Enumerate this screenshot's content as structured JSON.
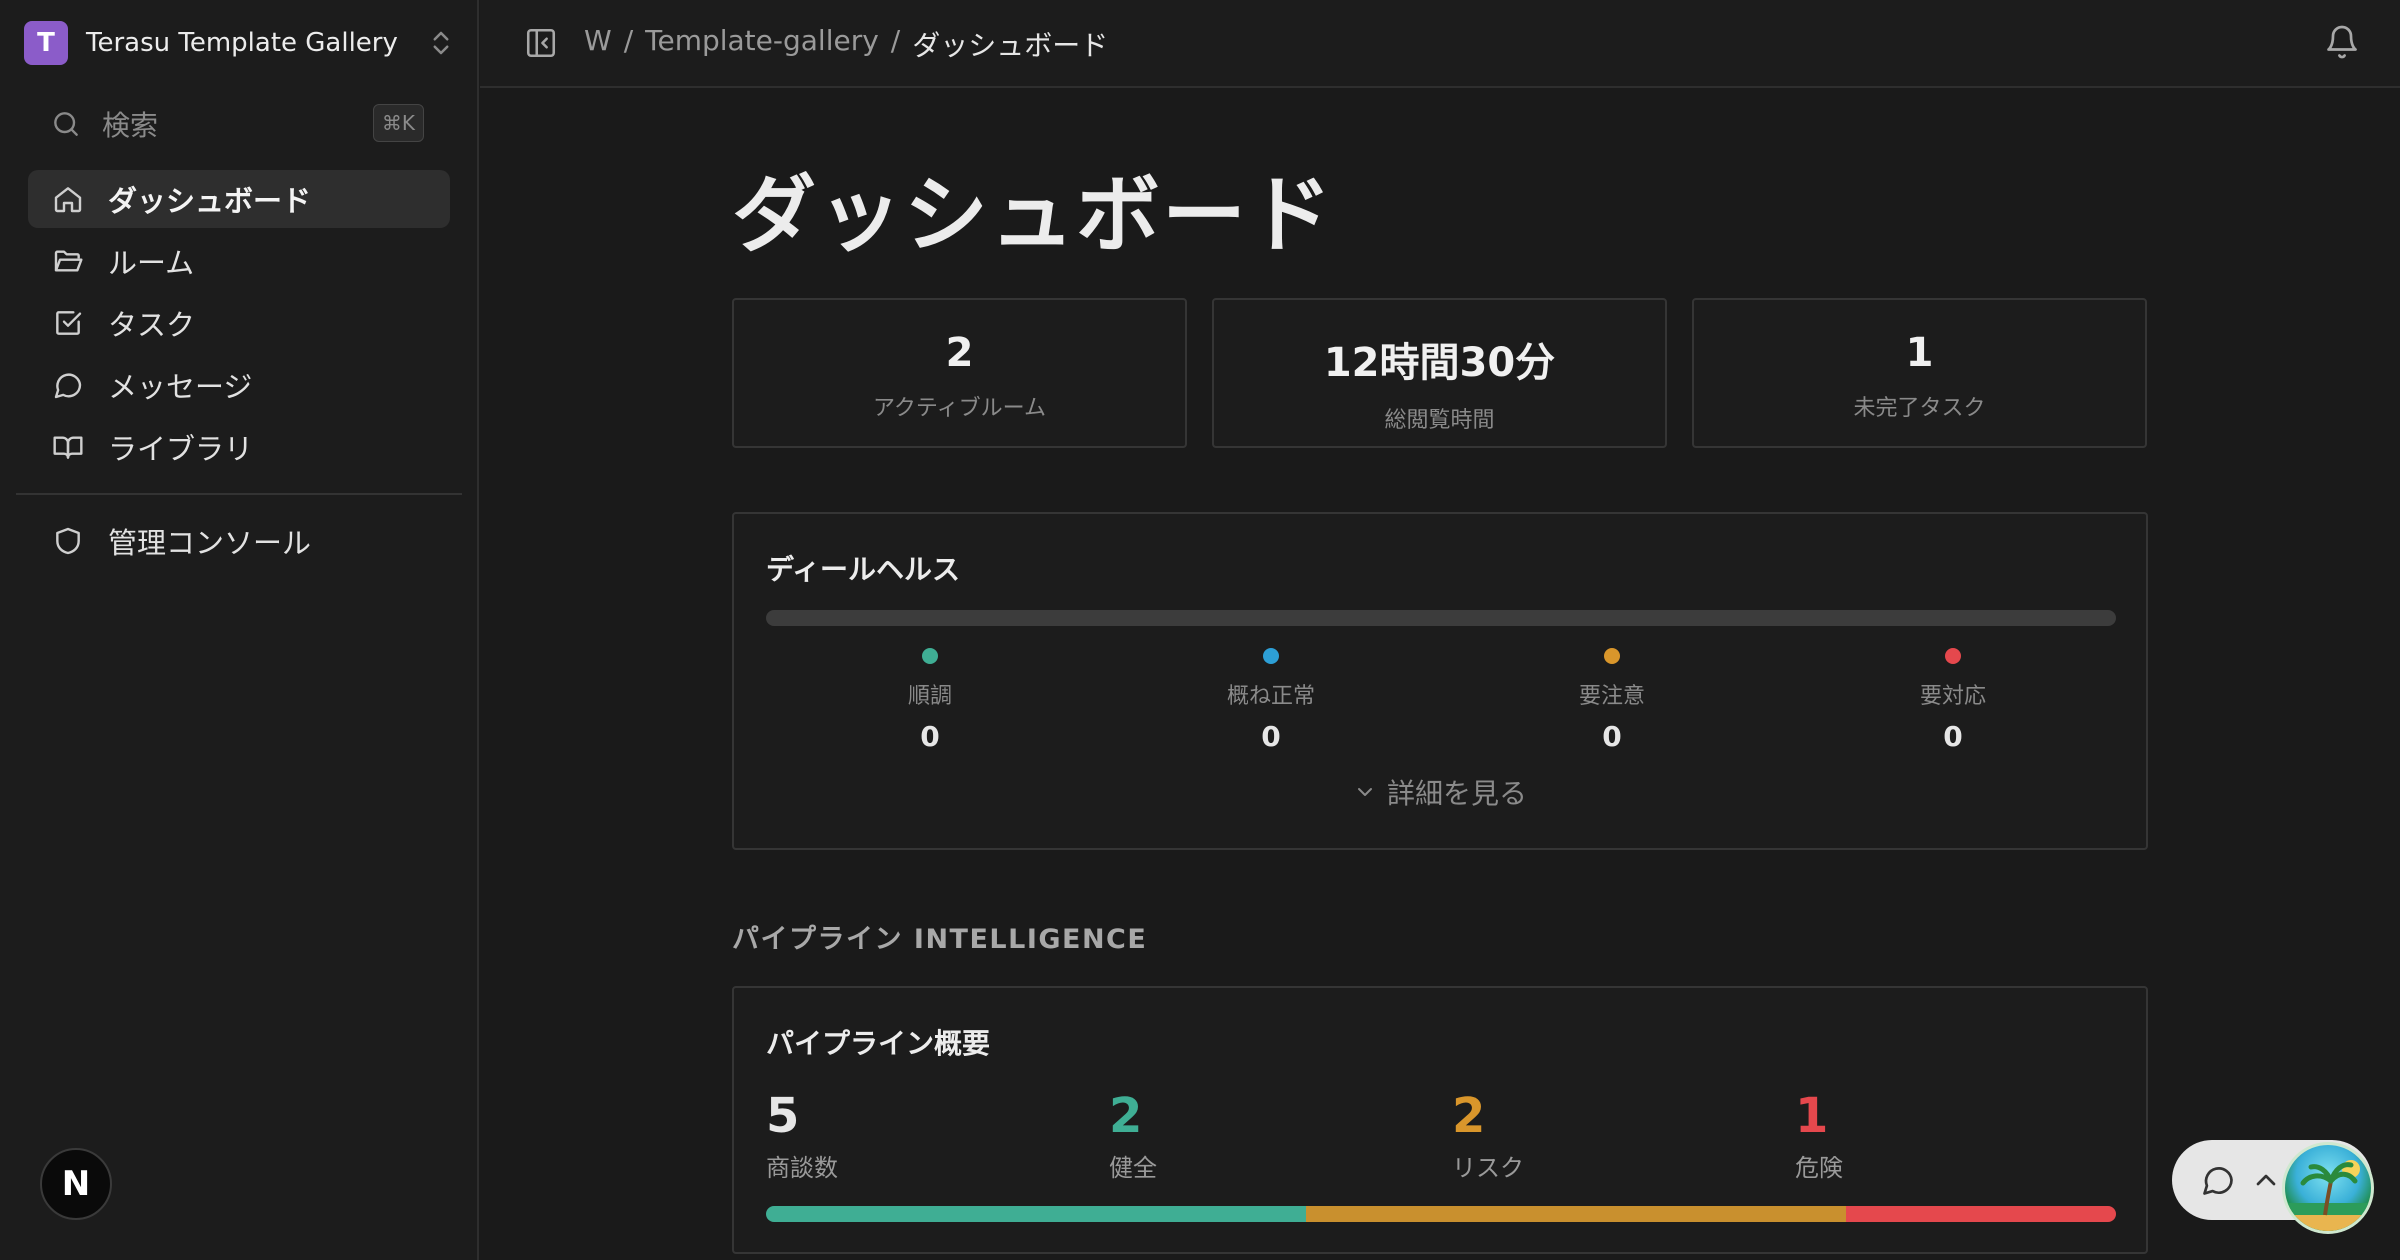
{
  "sidebar": {
    "workspace": {
      "initial": "T",
      "name": "Terasu Template Gallery"
    },
    "search": {
      "label": "検索",
      "shortcut": "⌘K"
    },
    "items": [
      {
        "label": "ダッシュボード",
        "icon": "home-icon",
        "active": true
      },
      {
        "label": "ルーム",
        "icon": "folder-open-icon",
        "active": false
      },
      {
        "label": "タスク",
        "icon": "checkbox-icon",
        "active": false
      },
      {
        "label": "メッセージ",
        "icon": "message-circle-icon",
        "active": false
      },
      {
        "label": "ライブラリ",
        "icon": "book-open-icon",
        "active": false
      }
    ],
    "admin": {
      "label": "管理コンソール",
      "icon": "shield-icon"
    },
    "user_initial": "N"
  },
  "header": {
    "breadcrumb": [
      "W",
      "/",
      "Template-gallery",
      "/",
      "ダッシュボード"
    ]
  },
  "page": {
    "title": "ダッシュボード"
  },
  "stats": [
    {
      "value": "2",
      "label": "アクティブルーム"
    },
    {
      "value": "12時間30分",
      "label": "総閲覧時間"
    },
    {
      "value": "1",
      "label": "未完了タスク"
    }
  ],
  "deal_health": {
    "title": "ディールヘルス",
    "items": [
      {
        "label": "順調",
        "value": "0",
        "color": "#3fae94"
      },
      {
        "label": "概ね正常",
        "value": "0",
        "color": "#2d9fd6"
      },
      {
        "label": "要注意",
        "value": "0",
        "color": "#d9962b"
      },
      {
        "label": "要対応",
        "value": "0",
        "color": "#e5484d"
      }
    ],
    "details_label": "詳細を見る"
  },
  "pipeline_section": {
    "title": "パイプライン INTELLIGENCE"
  },
  "pipeline_overview": {
    "title": "パイプライン概要",
    "metrics": [
      {
        "value": "5",
        "label": "商談数",
        "color": "#e6e6e6"
      },
      {
        "value": "2",
        "label": "健全",
        "color": "#3fae94"
      },
      {
        "value": "2",
        "label": "リスク",
        "color": "#d9962b"
      },
      {
        "value": "1",
        "label": "危険",
        "color": "#e5484d"
      }
    ],
    "bar_segments": [
      {
        "name": "健全",
        "value": 2,
        "color": "#3fae94"
      },
      {
        "name": "リスク",
        "value": 2,
        "color": "#c9902e"
      },
      {
        "name": "危険",
        "value": 1,
        "color": "#e5484d"
      }
    ]
  }
}
